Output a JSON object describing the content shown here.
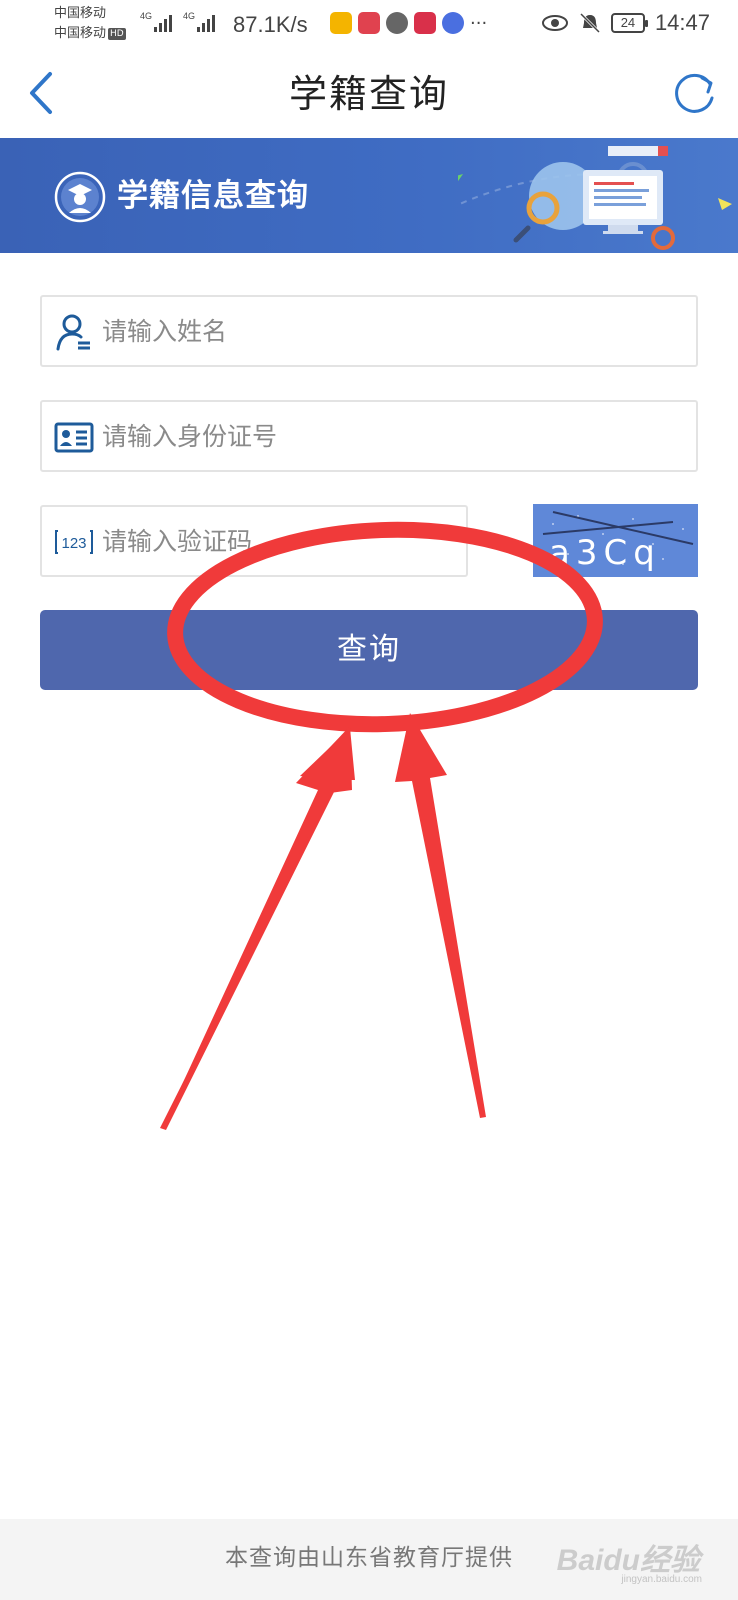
{
  "status_bar": {
    "carrier_1": "中国移动",
    "carrier_2": "中国移动",
    "hd_badge": "HD",
    "net_type_1": "4G",
    "net_type_2": "4G",
    "net_speed": "87.1K/s",
    "more_notifications": "···",
    "battery_level": "24",
    "time": "14:47"
  },
  "nav": {
    "title": "学籍查询"
  },
  "banner": {
    "title": "学籍信息查询"
  },
  "form": {
    "name_placeholder": "请输入姓名",
    "id_placeholder": "请输入身份证号",
    "captcha_placeholder": "请输入验证码",
    "captcha_text": "a3Cq",
    "id_icon_text": "123",
    "submit_label": "查询"
  },
  "footer": {
    "text": "本查询由山东省教育厅提供",
    "watermark": "Baidu经验",
    "watermark_sub": "jingyan.baidu.com"
  },
  "colors": {
    "accent": "#3f6cc3",
    "button": "#4f67ad",
    "annotation": "#f03a3a",
    "icon_blue": "#2f76c9"
  }
}
